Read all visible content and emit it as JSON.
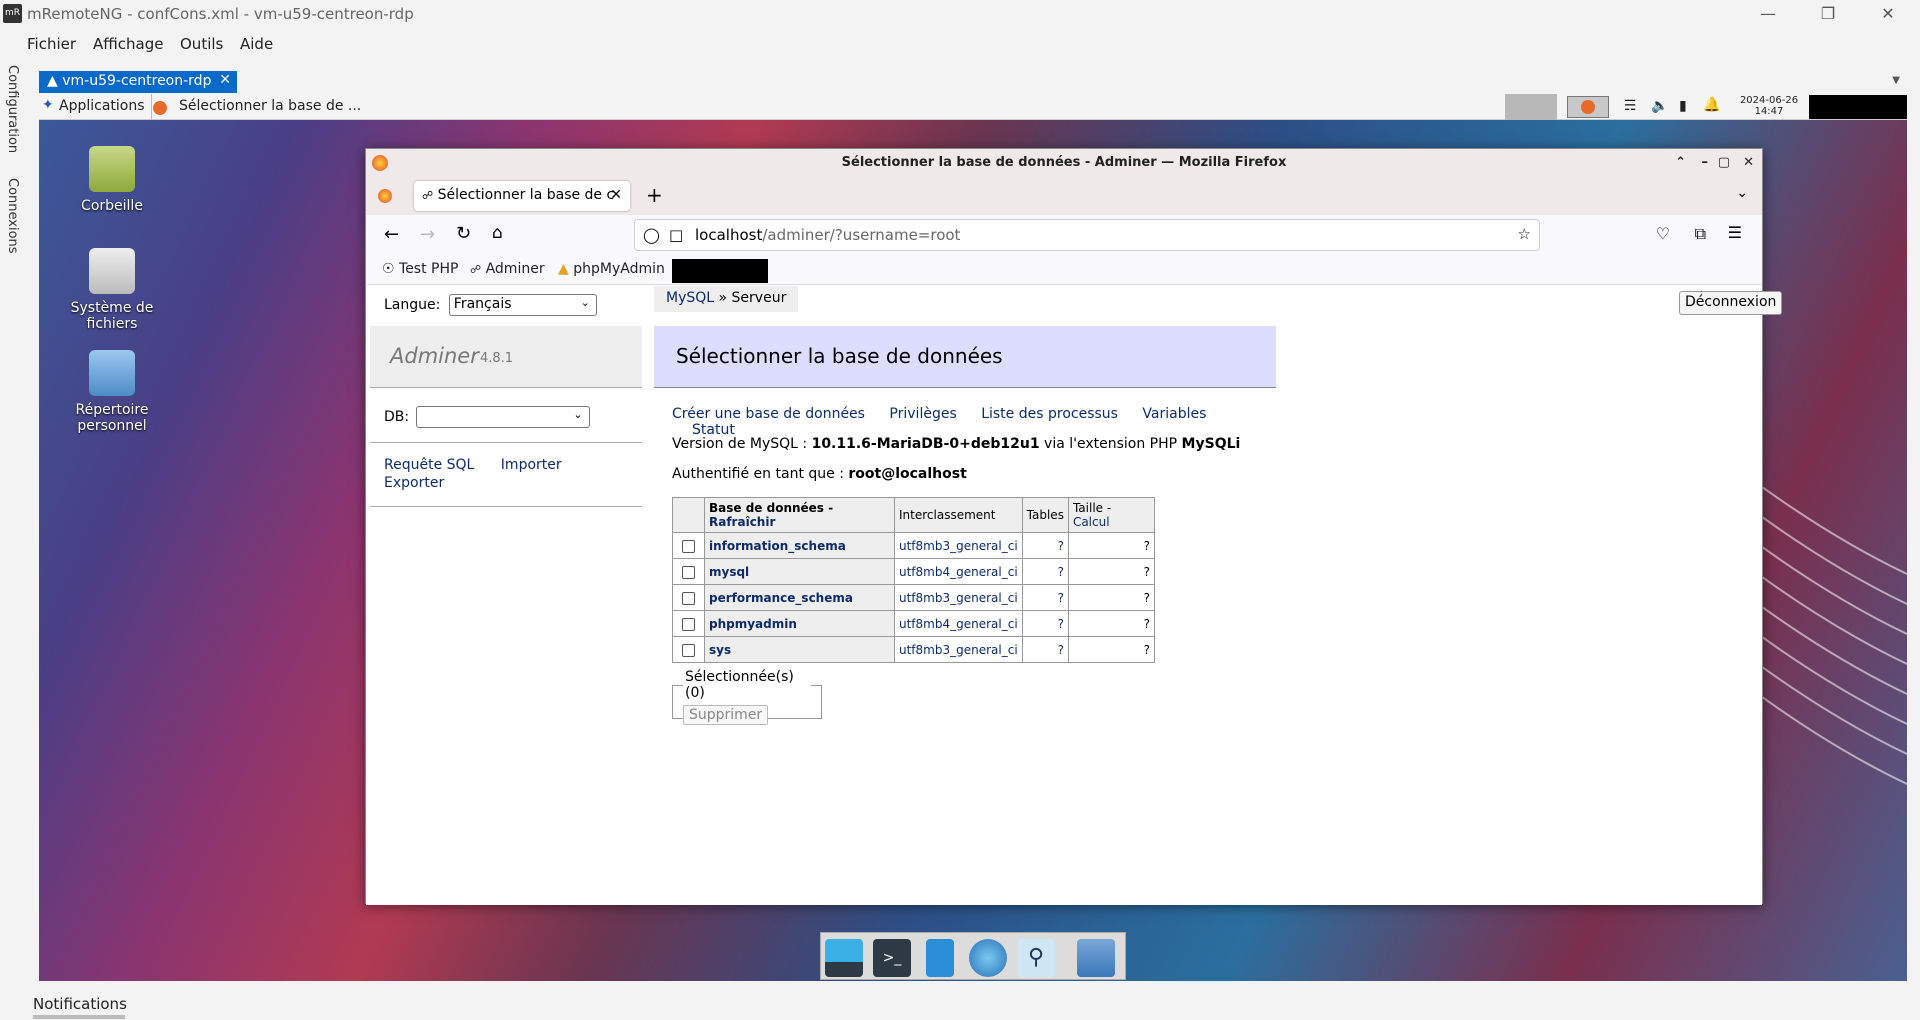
{
  "window": {
    "app_icon": "mR",
    "title": "mRemoteNG - confCons.xml - vm-u59-centreon-rdp",
    "controls": [
      "minimize-icon",
      "restore-icon",
      "close-icon"
    ]
  },
  "menu": [
    "Fichier",
    "Affichage",
    "Outils",
    "Aide"
  ],
  "side_tabs": [
    "Configuration",
    "Connexions"
  ],
  "connection_tab": {
    "label": "vm-u59-centreon-rdp",
    "close": "✕"
  },
  "remote_panel": {
    "applications": "Applications",
    "task": "Sélectionner la base de ...",
    "clock": {
      "date": "2024-06-26",
      "time": "14:47"
    }
  },
  "desktop_icons": [
    {
      "label": "Corbeille",
      "icon": "trash-icon"
    },
    {
      "label": "Système de fichiers",
      "icon": "drive-icon"
    },
    {
      "label": "Répertoire personnel",
      "icon": "home-folder-icon"
    }
  ],
  "firefox": {
    "title": "Sélectionner la base de données - Adminer — Mozilla Firefox",
    "tab_label": "Sélectionner la base de c",
    "new_tab": "+",
    "url_host": "localhost",
    "url_path": "/adminer/?username=root",
    "bookmarks": [
      "Test PHP",
      "Adminer",
      "phpMyAdmin"
    ]
  },
  "adminer": {
    "lang_label": "Langue:",
    "lang_value": "Français",
    "brand": "Adminer",
    "version": "4.8.1",
    "db_label": "DB:",
    "side_links": [
      "Requête SQL",
      "Importer",
      "Exporter"
    ],
    "breadcrumb_link": "MySQL",
    "breadcrumb_rest": " » Serveur",
    "logout": "Déconnexion",
    "heading": "Sélectionner la base de données",
    "links": [
      "Créer une base de données",
      "Privilèges",
      "Liste des processus",
      "Variables",
      "Statut"
    ],
    "version_prefix": "Version de MySQL : ",
    "version_value": "10.11.6-MariaDB-0+deb12u1",
    "version_mid": " via l'extension PHP ",
    "version_ext": "MySQLi",
    "auth_prefix": "Authentifié en tant que : ",
    "auth_user": "root@localhost",
    "table_headers": {
      "db": "Base de données",
      "refresh": "Rafraîchir",
      "collation": "Interclassement",
      "tables": "Tables",
      "size": "Taille",
      "calc": "Calcul"
    },
    "rows": [
      {
        "name": "information_schema",
        "collation": "utf8mb3_general_ci",
        "tables": "?",
        "size": "?"
      },
      {
        "name": "mysql",
        "collation": "utf8mb4_general_ci",
        "tables": "?",
        "size": "?"
      },
      {
        "name": "performance_schema",
        "collation": "utf8mb3_general_ci",
        "tables": "?",
        "size": "?"
      },
      {
        "name": "phpmyadmin",
        "collation": "utf8mb4_general_ci",
        "tables": "?",
        "size": "?"
      },
      {
        "name": "sys",
        "collation": "utf8mb3_general_ci",
        "tables": "?",
        "size": "?"
      }
    ],
    "selected_legend": "Sélectionnée(s) (0)",
    "delete_button": "Supprimer"
  },
  "notifications": "Notifications"
}
